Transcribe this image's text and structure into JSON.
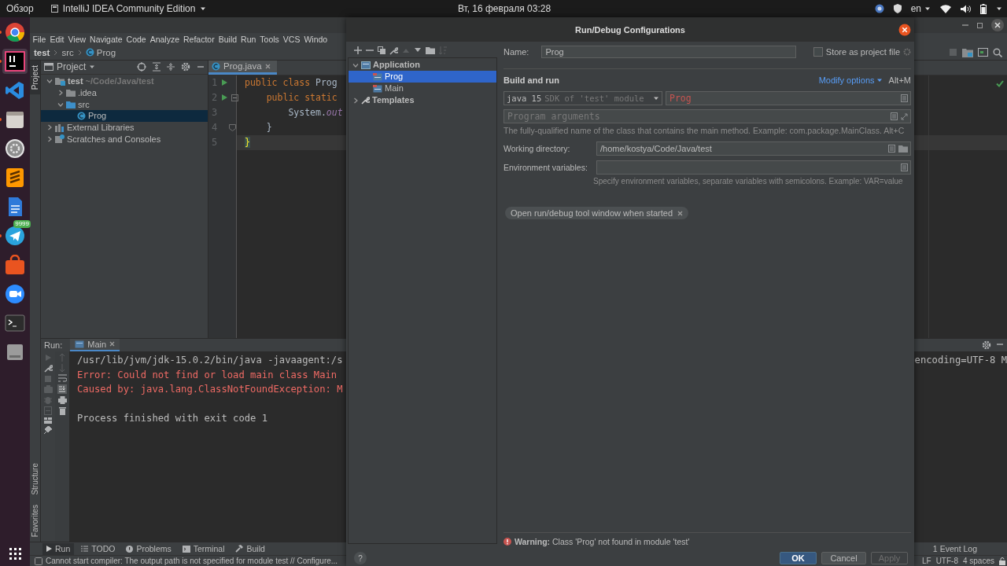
{
  "top_bar": {
    "activities": "Обзор",
    "app_menu": "IntelliJ IDEA Community Edition",
    "clock": "Вт, 16 февраля  03:28",
    "keyboard_layout": "en"
  },
  "dock": {
    "apps": [
      {
        "kind": "browser",
        "running": true,
        "selected": false
      },
      {
        "kind": "ide",
        "running": true,
        "selected": true
      },
      {
        "kind": "code-editor",
        "running": false,
        "selected": false
      },
      {
        "kind": "files",
        "running": true,
        "selected": false
      },
      {
        "kind": "settings",
        "running": false,
        "selected": false
      },
      {
        "kind": "text-editor",
        "running": false,
        "selected": false
      },
      {
        "kind": "document",
        "running": false,
        "selected": false
      },
      {
        "kind": "messenger",
        "running": true,
        "selected": false,
        "badge": "9999"
      },
      {
        "kind": "store",
        "running": false,
        "selected": false
      },
      {
        "kind": "video",
        "running": false,
        "selected": false
      },
      {
        "kind": "terminal",
        "running": false,
        "selected": false
      },
      {
        "kind": "disk",
        "running": false,
        "selected": false
      }
    ]
  },
  "menu_bar": [
    "File",
    "Edit",
    "View",
    "Navigate",
    "Code",
    "Analyze",
    "Refactor",
    "Build",
    "Run",
    "Tools",
    "VCS",
    "Windo"
  ],
  "breadcrumbs": [
    "test",
    "src",
    "Prog"
  ],
  "side_tabs": {
    "top": [
      {
        "label": "Project",
        "selected": true
      }
    ],
    "bottom": [
      {
        "label": "Structure",
        "selected": false
      },
      {
        "label": "Favorites",
        "selected": false
      }
    ]
  },
  "project_panel": {
    "title": "Project",
    "tree": [
      {
        "label": "test",
        "hint": "~/Code/Java/test",
        "kind": "module",
        "expanded": true,
        "selected": false,
        "children": [
          {
            "label": ".idea",
            "kind": "folder",
            "expanded": false,
            "selected": false
          },
          {
            "label": "src",
            "kind": "source",
            "expanded": true,
            "selected": false,
            "children": [
              {
                "label": "Prog",
                "kind": "class",
                "selected": true
              }
            ]
          }
        ]
      },
      {
        "label": "External Libraries",
        "kind": "library",
        "expanded": false,
        "selected": false
      },
      {
        "label": "Scratches and Consoles",
        "kind": "scratch",
        "expanded": false,
        "selected": false
      }
    ]
  },
  "editor": {
    "tabs": [
      {
        "label": "Prog.java",
        "selected": true
      }
    ],
    "lines": [
      {
        "number": "1",
        "run": true,
        "current": false,
        "fold_start": false,
        "fold_end": false,
        "tokens": [
          {
            "kind": "keyword",
            "text": "public class"
          },
          {
            "kind": "plain",
            "text": " Prog"
          }
        ]
      },
      {
        "number": "2",
        "run": true,
        "current": false,
        "fold_start": true,
        "fold_end": false,
        "tokens": [
          {
            "kind": "keyword",
            "text": "    public static"
          }
        ]
      },
      {
        "number": "3",
        "run": false,
        "current": false,
        "fold_start": false,
        "fold_end": false,
        "tokens": [
          {
            "kind": "plain",
            "text": "        System."
          },
          {
            "kind": "field",
            "text": "out"
          }
        ]
      },
      {
        "number": "4",
        "run": false,
        "current": false,
        "fold_start": false,
        "fold_end": true,
        "tokens": [
          {
            "kind": "plain",
            "text": "    }"
          }
        ]
      },
      {
        "number": "5",
        "run": false,
        "current": true,
        "fold_start": false,
        "fold_end": false,
        "tokens": [
          {
            "kind": "brace-match",
            "text": "}"
          }
        ]
      }
    ]
  },
  "run_panel": {
    "title": "Run:",
    "tabs": [
      {
        "label": "Main",
        "selected": true
      }
    ],
    "console": [
      {
        "kind": "normal",
        "text": "/usr/lib/jvm/jdk-15.0.2/bin/java -javaagent:/s",
        "tail": "encoding=UTF-8 M"
      },
      {
        "kind": "error",
        "text": "Error: Could not find or load main class Main"
      },
      {
        "kind": "error",
        "text": "Caused by: java.lang.ClassNotFoundException: M"
      },
      {
        "kind": "blank"
      },
      {
        "kind": "normal",
        "text": "Process finished with exit code 1"
      }
    ]
  },
  "tool_tabs": [
    {
      "label": "Run",
      "kind": "run",
      "selected": true
    },
    {
      "label": "TODO",
      "kind": "todo",
      "selected": false
    },
    {
      "label": "Problems",
      "kind": "problems",
      "selected": false
    },
    {
      "label": "Terminal",
      "kind": "terminal",
      "selected": false
    },
    {
      "label": "Build",
      "kind": "build",
      "selected": false
    }
  ],
  "event_log": {
    "label": "Event Log",
    "count": "1"
  },
  "status_bar": {
    "message": "Cannot start compiler: The output path is not specified for module test // Configure...",
    "line_separator": "LF",
    "encoding": "UTF-8",
    "indent": "4 spaces"
  },
  "dialog": {
    "title": "Run/Debug Configurations",
    "tree": [
      {
        "label": "Application",
        "kind": "group",
        "expanded": true,
        "selected": false,
        "children": [
          {
            "label": "Prog",
            "kind": "config",
            "selected": true
          },
          {
            "label": "Main",
            "kind": "config",
            "selected": false
          }
        ]
      },
      {
        "label": "Templates",
        "kind": "templates",
        "expanded": false,
        "selected": false
      }
    ],
    "name_label": "Name:",
    "name": "Prog",
    "store_label": "Store as project file",
    "store_checked": false,
    "section": "Build and run",
    "modify_options": "Modify options",
    "modify_shortcut": "Alt+M",
    "jdk": {
      "name": "java 15",
      "detail": "SDK of 'test' module"
    },
    "main_class": {
      "value": "Prog",
      "invalid": true
    },
    "program_args": {
      "placeholder": "Program arguments"
    },
    "main_class_hint": "The fully-qualified name of the class that contains the main method. Example: com.package.MainClass. Alt+C",
    "working_dir": {
      "label": "Working directory:",
      "value": "/home/kostya/Code/Java/test"
    },
    "env": {
      "label": "Environment variables:",
      "hint": "Specify environment variables, separate variables with semicolons. Example: VAR=value"
    },
    "options": [
      {
        "label": "Open run/debug tool window when started"
      }
    ],
    "warning": "**Warning:** Class 'Prog' not found in module 'test'",
    "help": "?",
    "buttons": [
      {
        "label": "OK",
        "default": true,
        "disabled": false
      },
      {
        "label": "Cancel",
        "default": false,
        "disabled": false
      },
      {
        "label": "Apply",
        "default": false,
        "disabled": true
      }
    ]
  }
}
